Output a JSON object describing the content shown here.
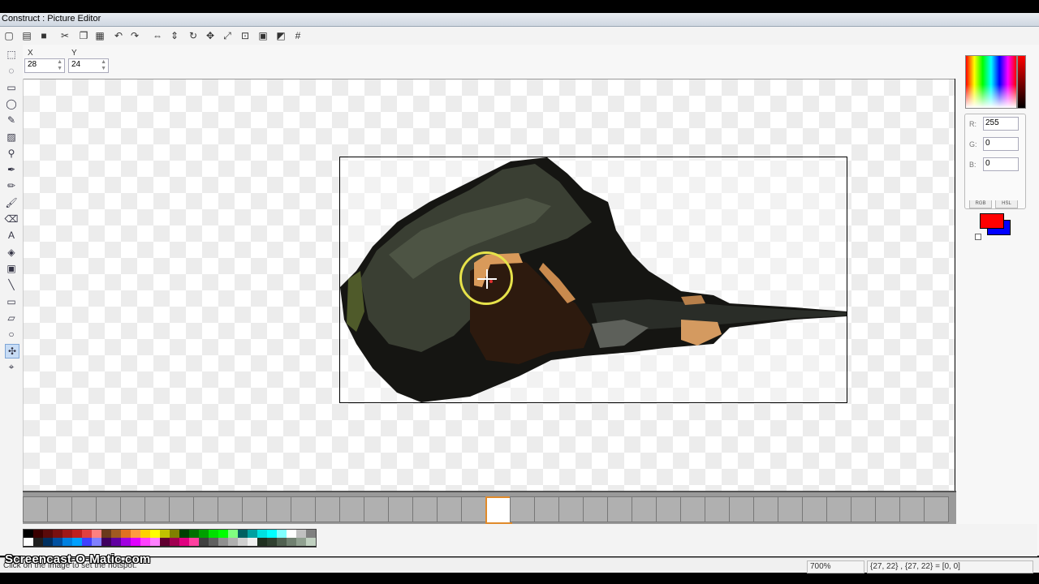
{
  "window": {
    "title": "Construct : Picture Editor"
  },
  "toolbar": {
    "buttons": [
      {
        "name": "new-icon",
        "glyph": "▢"
      },
      {
        "name": "open-icon",
        "glyph": "▤"
      },
      {
        "name": "save-icon",
        "glyph": "■"
      },
      {
        "name": "cut-icon",
        "glyph": "✂"
      },
      {
        "name": "copy-icon",
        "glyph": "❐"
      },
      {
        "name": "paste-icon",
        "glyph": "▦"
      },
      {
        "name": "undo-icon",
        "glyph": "↶"
      },
      {
        "name": "redo-icon",
        "glyph": "↷"
      },
      {
        "name": "flip-horizontal-icon",
        "glyph": "⇔"
      },
      {
        "name": "flip-vertical-icon",
        "glyph": "⇕"
      },
      {
        "name": "rotate-icon",
        "glyph": "↻"
      },
      {
        "name": "move-icon",
        "glyph": "✥"
      },
      {
        "name": "resize-icon",
        "glyph": "⤢"
      },
      {
        "name": "crop-icon",
        "glyph": "⊡"
      },
      {
        "name": "image-settings-icon",
        "glyph": "▣"
      },
      {
        "name": "effects-icon",
        "glyph": "◩"
      },
      {
        "name": "grid-icon",
        "glyph": "#"
      }
    ]
  },
  "options": {
    "x_label": "X",
    "x_value": "28",
    "y_label": "Y",
    "y_value": "24"
  },
  "tools": [
    {
      "name": "select-tool-icon",
      "glyph": "⬚"
    },
    {
      "name": "lasso-tool-icon",
      "glyph": "◌"
    },
    {
      "name": "rect-select-tool-icon",
      "glyph": "▭"
    },
    {
      "name": "ellipse-select-tool-icon",
      "glyph": "◯"
    },
    {
      "name": "wand-tool-icon",
      "glyph": "✎"
    },
    {
      "name": "image-tool-icon",
      "glyph": "▨"
    },
    {
      "name": "zoom-tool-icon",
      "glyph": "⚲"
    },
    {
      "name": "eyedropper-tool-icon",
      "glyph": "✒"
    },
    {
      "name": "pencil-tool-icon",
      "glyph": "✏"
    },
    {
      "name": "brush-tool-icon",
      "glyph": "🖌"
    },
    {
      "name": "eraser-tool-icon",
      "glyph": "⌫"
    },
    {
      "name": "text-tool-icon",
      "glyph": "A"
    },
    {
      "name": "fill-tool-icon",
      "glyph": "◈"
    },
    {
      "name": "stamp-tool-icon",
      "glyph": "▣"
    },
    {
      "name": "line-tool-icon",
      "glyph": "╲"
    },
    {
      "name": "rectangle-tool-icon",
      "glyph": "▭"
    },
    {
      "name": "polygon-tool-icon",
      "glyph": "▱"
    },
    {
      "name": "ellipse-tool-icon",
      "glyph": "○"
    },
    {
      "name": "hotspot-tool-icon",
      "glyph": "✣",
      "active": true
    },
    {
      "name": "action-point-tool-icon",
      "glyph": "⌖"
    }
  ],
  "color": {
    "r_label": "R:",
    "r_value": "255",
    "g_label": "G:",
    "g_value": "0",
    "b_label": "B:",
    "b_value": "0",
    "tab_rgb": "RGB",
    "tab_hsl": "HSL",
    "foreground": "#ff0000",
    "background": "#0000ff"
  },
  "frames": {
    "count": 38,
    "selected_index": 19
  },
  "palette": [
    "#000000",
    "#3a0000",
    "#5a0a0a",
    "#7a1010",
    "#a01818",
    "#c02020",
    "#e04040",
    "#ff8080",
    "#6b3a1a",
    "#a05a20",
    "#e07020",
    "#ff9a40",
    "#ffd000",
    "#ffff00",
    "#c0c000",
    "#808000",
    "#004000",
    "#007000",
    "#00a000",
    "#00e000",
    "#00ff00",
    "#80ff80",
    "#006060",
    "#00a0a0",
    "#00e0e0",
    "#00ffff",
    "#80ffff",
    "#ffffff",
    "#c0c0c0",
    "#808080",
    "#ffffff",
    "#202020",
    "#003060",
    "#0050a0",
    "#0080e0",
    "#00a0ff",
    "#4040ff",
    "#8080ff",
    "#400060",
    "#6000a0",
    "#a000e0",
    "#e000ff",
    "#ff40ff",
    "#ff80ff",
    "#600030",
    "#a00050",
    "#e00080",
    "#ff40a0",
    "#404040",
    "#606060",
    "#909090",
    "#b0b0b0",
    "#d0d0d0",
    "#f0f0f0",
    "#203020",
    "#304030",
    "#506050",
    "#708070",
    "#90a090",
    "#c0d0c0"
  ],
  "status": {
    "hint": "Click on the image to set the hotspot.",
    "zoom": "700%",
    "coords": "{27, 22} , {27, 22} = [0, 0]"
  },
  "watermark": "Screencast-O-Matic.com"
}
